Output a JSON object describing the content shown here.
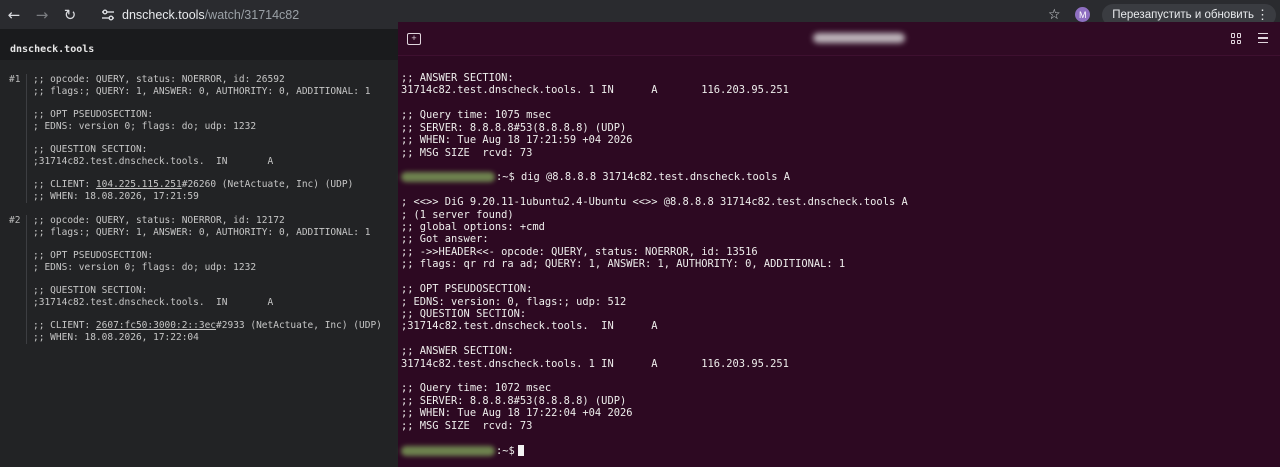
{
  "browser": {
    "url_host": "dnscheck.tools",
    "url_path": "/watch/31714c82",
    "avatar_letter": "M",
    "relaunch_label": "Перезапустить и обновить"
  },
  "app": {
    "brand": "dnscheck.tools",
    "entries": [
      {
        "num": "#1",
        "header_1": ";; opcode: QUERY, status: NOERROR, id: 26592",
        "header_2": ";; flags:; QUERY: 1, ANSWER: 0, AUTHORITY: 0, ADDITIONAL: 1",
        "opt_title": ";; OPT PSEUDOSECTION:",
        "opt_line": "; EDNS: version 0; flags: do; udp: 1232",
        "q_title": ";; QUESTION SECTION:",
        "q_line": ";31714c82.test.dnscheck.tools.  IN       A",
        "client_prefix": ";; CLIENT: ",
        "client_ip": "104.225.115.251",
        "client_suffix": "#26260 (NetActuate, Inc) (UDP)",
        "when": ";; WHEN: 18.08.2026, 17:21:59"
      },
      {
        "num": "#2",
        "header_1": ";; opcode: QUERY, status: NOERROR, id: 12172",
        "header_2": ";; flags:; QUERY: 1, ANSWER: 0, AUTHORITY: 0, ADDITIONAL: 1",
        "opt_title": ";; OPT PSEUDOSECTION:",
        "opt_line": "; EDNS: version 0; flags: do; udp: 1232",
        "q_title": ";; QUESTION SECTION:",
        "q_line": ";31714c82.test.dnscheck.tools.  IN       A",
        "client_prefix": ";; CLIENT: ",
        "client_ip": "2607:fc50:3000:2::3ec",
        "client_suffix": "#2933 (NetActuate, Inc) (UDP)",
        "when": ";; WHEN: 18.08.2026, 17:22:04"
      }
    ]
  },
  "terminal": {
    "lines": [
      ";; ANSWER SECTION:",
      "31714c82.test.dnscheck.tools. 1 IN      A       116.203.95.251",
      "",
      ";; Query time: 1075 msec",
      ";; SERVER: 8.8.8.8#53(8.8.8.8) (UDP)",
      ";; WHEN: Tue Aug 18 17:21:59 +04 2026",
      ";; MSG SIZE  rcvd: 73",
      "",
      "",
      "",
      "; <<>> DiG 9.20.11-1ubuntu2.4-Ubuntu <<>> @8.8.8.8 31714c82.test.dnscheck.tools A",
      "; (1 server found)",
      ";; global options: +cmd",
      ";; Got answer:",
      ";; ->>HEADER<<- opcode: QUERY, status: NOERROR, id: 13516",
      ";; flags: qr rd ra ad; QUERY: 1, ANSWER: 1, AUTHORITY: 0, ADDITIONAL: 1",
      "",
      ";; OPT PSEUDOSECTION:",
      "; EDNS: version: 0, flags:; udp: 512",
      ";; QUESTION SECTION:",
      ";31714c82.test.dnscheck.tools.  IN      A",
      "",
      ";; ANSWER SECTION:",
      "31714c82.test.dnscheck.tools. 1 IN      A       116.203.95.251",
      "",
      ";; Query time: 1072 msec",
      ";; SERVER: 8.8.8.8#53(8.8.8.8) (UDP)",
      ";; WHEN: Tue Aug 18 17:22:04 +04 2026",
      ";; MSG SIZE  rcvd: 73"
    ],
    "prompt_command": ":~$ dig @8.8.8.8 31714c82.test.dnscheck.tools A",
    "prompt_final": ":~$"
  }
}
